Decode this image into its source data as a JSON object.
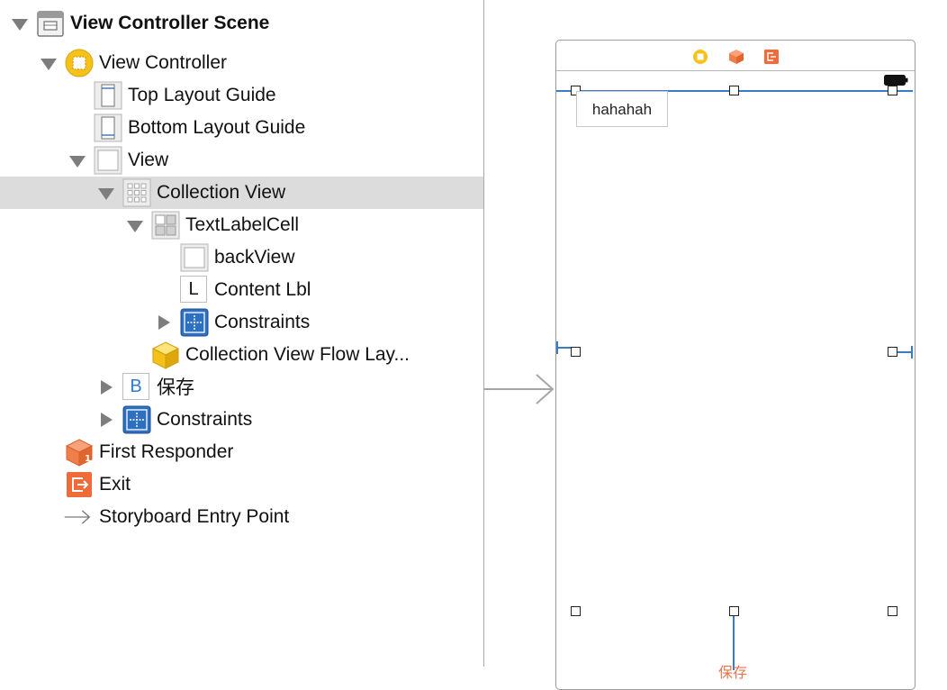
{
  "outline": {
    "items": [
      {
        "label": "View Controller Scene",
        "icon": "scene-icon"
      },
      {
        "label": "View Controller",
        "icon": "view-controller-icon"
      },
      {
        "label": "Top Layout Guide",
        "icon": "top-layout-guide-icon"
      },
      {
        "label": "Bottom Layout Guide",
        "icon": "bottom-layout-guide-icon"
      },
      {
        "label": "View",
        "icon": "view-icon"
      },
      {
        "label": "Collection View",
        "icon": "collection-view-icon"
      },
      {
        "label": "TextLabelCell",
        "icon": "collection-cell-icon"
      },
      {
        "label": "backView",
        "icon": "view-icon"
      },
      {
        "label": "Content Lbl",
        "icon": "label-icon",
        "glyph": "L"
      },
      {
        "label": "Constraints",
        "icon": "constraints-icon"
      },
      {
        "label": "Collection View Flow Lay...",
        "icon": "flow-layout-cube-icon"
      },
      {
        "label": "保存",
        "icon": "button-icon",
        "glyph": "B"
      },
      {
        "label": "Constraints",
        "icon": "constraints-icon"
      },
      {
        "label": "First Responder",
        "icon": "first-responder-icon"
      },
      {
        "label": "Exit",
        "icon": "exit-icon"
      },
      {
        "label": "Storyboard Entry Point",
        "icon": "entry-arrow-icon"
      }
    ]
  },
  "canvas": {
    "cell_label": "hahahah",
    "bottom_partial_text": "保存"
  },
  "colors": {
    "selection": "#dcdcdc",
    "constraint_blue": "#3b7cc4",
    "vc_yellow": "#f6c21a",
    "responder_orange": "#ef7e4a",
    "exit_orange": "#ef6b3a",
    "button_text_red": "#e8754f"
  }
}
